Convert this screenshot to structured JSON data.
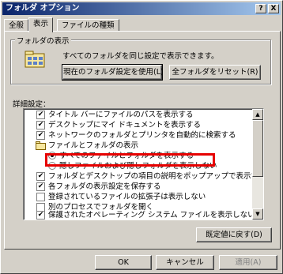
{
  "window": {
    "title": "フォルダ オプション",
    "help_btn": "?",
    "close_btn": "X"
  },
  "tabs": [
    {
      "label": "全般"
    },
    {
      "label": "表示"
    },
    {
      "label": "ファイルの種類"
    }
  ],
  "folder_view": {
    "group_title": "フォルダの表示",
    "description": "すべてのフォルダを同じ設定で表示できます。",
    "apply_button": "現在のフォルダ設定を使用(L)",
    "reset_button": "全フォルダをリセット(R)"
  },
  "advanced": {
    "label": "詳細設定：",
    "items": [
      {
        "type": "checkbox",
        "checked": true,
        "label": "タイトル バーにファイルのパスを表示する"
      },
      {
        "type": "checkbox",
        "checked": true,
        "label": "デスクトップにマイ ドキュメントを表示する"
      },
      {
        "type": "checkbox",
        "checked": true,
        "label": "ネットワークのフォルダとプリンタを自動的に検索する"
      },
      {
        "type": "folder",
        "label": "ファイルとフォルダの表示"
      },
      {
        "type": "radio",
        "checked": true,
        "label": "すべてのファイルとフォルダを表示する"
      },
      {
        "type": "radio",
        "checked": false,
        "label": "隠しファイルおよび隠しフォルダを表示しない"
      },
      {
        "type": "checkbox",
        "checked": true,
        "label": "フォルダとデスクトップの項目の説明をポップアップで表示する"
      },
      {
        "type": "checkbox",
        "checked": true,
        "label": "各フォルダの表示設定を保存する"
      },
      {
        "type": "checkbox",
        "checked": false,
        "label": "登録されているファイルの拡張子は表示しない"
      },
      {
        "type": "checkbox",
        "checked": false,
        "label": "別のプロセスでフォルダを開く"
      },
      {
        "type": "checkbox",
        "checked": true,
        "label": "保護されたオペレーティング システム ファイルを表示しない (推奨)"
      }
    ],
    "restore_button": "既定値に戻す(D)"
  },
  "footer": {
    "ok": "OK",
    "cancel": "キャンセル",
    "apply": "適用(A)"
  },
  "colors": {
    "face": "#d4d0c8",
    "title_start": "#0a246a",
    "title_end": "#a6caf0",
    "highlight": "#e60000"
  }
}
